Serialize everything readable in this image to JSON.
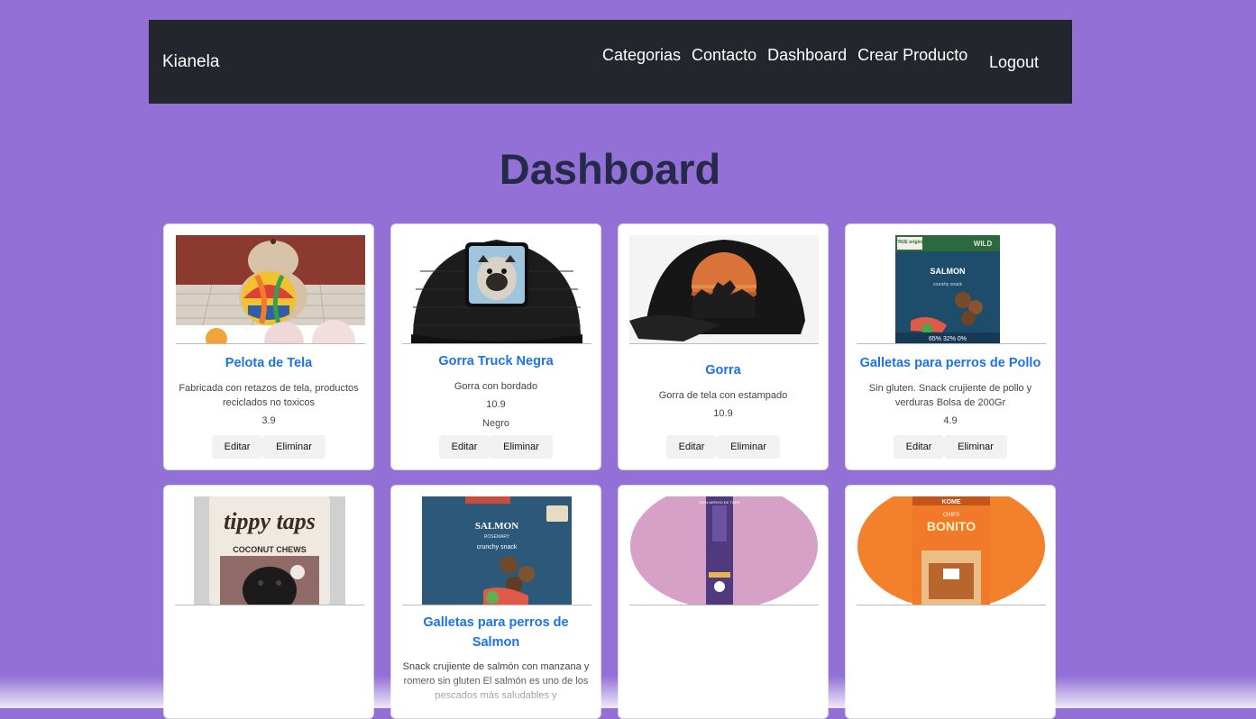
{
  "navbar": {
    "brand": "Kianela",
    "links": [
      "Categorias",
      "Contacto",
      "Dashboard",
      "Crear Producto"
    ],
    "logout": "Logout"
  },
  "page_title": "Dashboard",
  "buttons": {
    "edit": "Editar",
    "delete": "Eliminar"
  },
  "products": [
    {
      "title": "Pelota de Tela",
      "desc": "Fabricada con retazos de tela, productos reciclados no toxicos",
      "price": "3.9",
      "color": ""
    },
    {
      "title": "Gorra Truck Negra",
      "desc": "Gorra con bordado",
      "price": "10.9",
      "color": "Negro"
    },
    {
      "title": "Gorra",
      "desc": "Gorra de tela con estampado",
      "price": "10.9",
      "color": ""
    },
    {
      "title": "Galletas para perros de Pollo",
      "desc": "Sin gluten. Snack crujiente de pollo y verduras Bolsa de 200Gr",
      "price": "4.9",
      "color": ""
    },
    {
      "title": "",
      "desc": "",
      "price": "",
      "color": ""
    },
    {
      "title": "Galletas para perros de Salmon",
      "desc": "Snack crujiente de salmón con manzana y romero sin gluten El salmón es uno de los pescados más saludables y",
      "price": "",
      "color": ""
    },
    {
      "title": "",
      "desc": "",
      "price": "",
      "color": ""
    },
    {
      "title": "",
      "desc": "",
      "price": "",
      "color": ""
    }
  ],
  "image_text": {
    "salmon_brand": "TRUE origins",
    "salmon_tag": "WILD",
    "salmon_name": "SALMON",
    "salmon_snack": "crunchy snack",
    "salmon_pcts": "65%  32%  0%",
    "tippy_brand": "tippy taps",
    "tippy_flavor": "COCONUT CHEWS",
    "bag2_name": "SALMON",
    "bag2_sub": "ROSEMARY",
    "bag2_snack": "crunchy snack",
    "nervio": "100% NERVIO DE TORO",
    "bonito_brand": "KOME",
    "bonito_name": "BONITO",
    "bonito_pre": "CHIPS"
  },
  "colors": {
    "background": "#9370d6",
    "navbar": "#23262d",
    "title_link": "#1a73e8",
    "heading": "#262a4a"
  }
}
